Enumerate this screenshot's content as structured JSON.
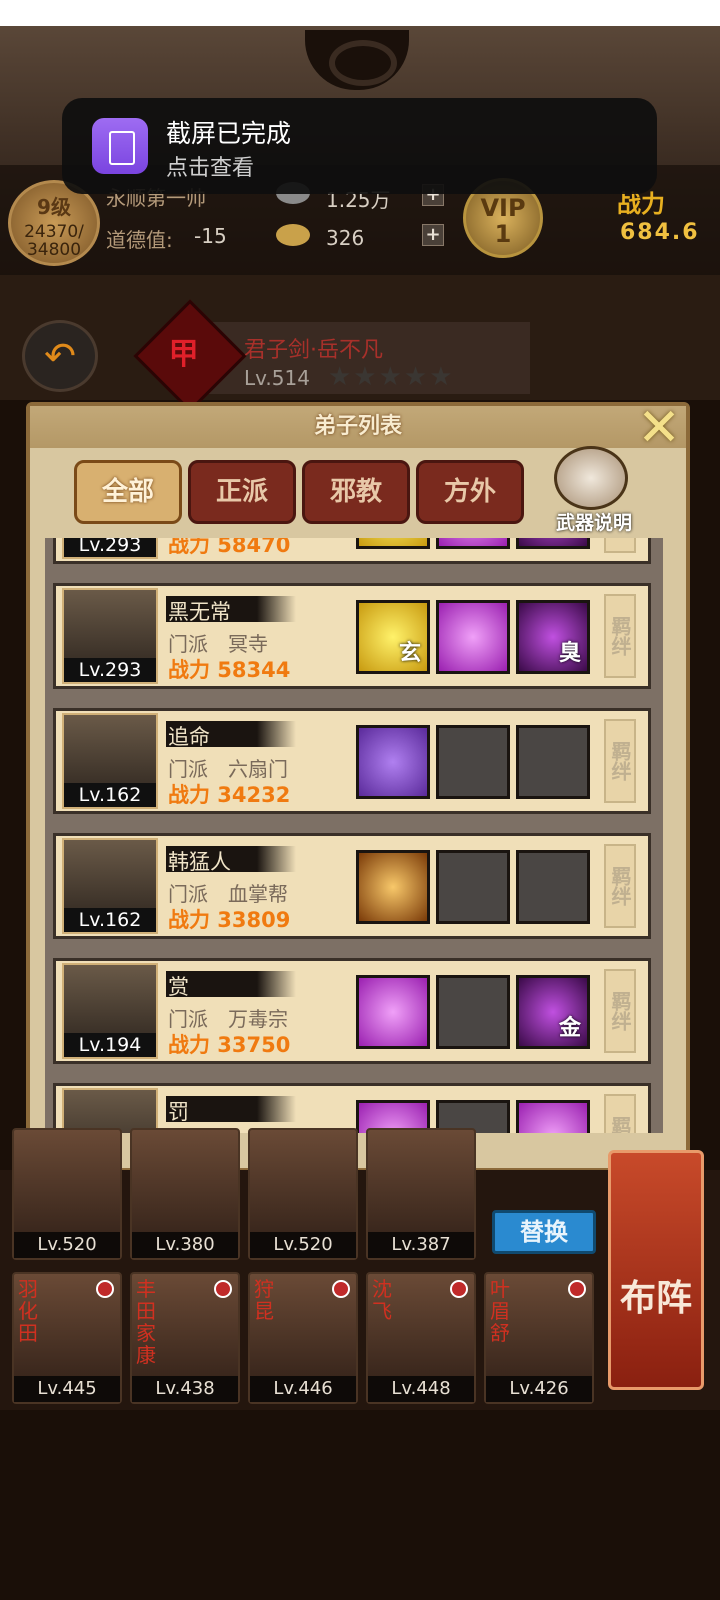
{
  "notification": {
    "title": "截屏已完成",
    "subtitle": "点击查看"
  },
  "player": {
    "level": "9级",
    "exp": "24370/",
    "exp_max": "34800",
    "name": "永顺第一帅",
    "morality_label": "道德值:",
    "morality_value": "-15",
    "silver": "1.25万",
    "gold": "326",
    "vip_label": "VIP",
    "vip_level": "1",
    "power_label": "战力",
    "power_value": "684.6"
  },
  "hero": {
    "rank": "甲等",
    "name": "君子剑·岳不凡",
    "level": "Lv.514",
    "stars": "★★★★★"
  },
  "dialog": {
    "title": "弟子列表",
    "tabs": [
      "全部",
      "正派",
      "邪教",
      "方外"
    ],
    "weapon_label": "武器说明"
  },
  "disciples": [
    {
      "level": "Lv.293",
      "name": "",
      "sect": "",
      "power": "战力 58470",
      "skills": [
        "yellow",
        "purple",
        "dark"
      ],
      "skill_tags": [
        "",
        "",
        ""
      ]
    },
    {
      "level": "Lv.293",
      "name": "黑无常",
      "sect": "门派　冥寺",
      "power": "战力 58344",
      "skills": [
        "yellow",
        "purple",
        "dark"
      ],
      "skill_tags": [
        "玄",
        "",
        "臭"
      ]
    },
    {
      "level": "Lv.162",
      "name": "追命",
      "sect": "门派　六扇门",
      "power": "战力 34232",
      "skills": [
        "violet",
        "empty",
        "empty"
      ],
      "skill_tags": [
        "",
        "",
        ""
      ]
    },
    {
      "level": "Lv.162",
      "name": "韩猛人",
      "sect": "门派　血掌帮",
      "power": "战力 33809",
      "skills": [
        "gold",
        "empty",
        "empty"
      ],
      "skill_tags": [
        "",
        "",
        ""
      ]
    },
    {
      "level": "Lv.194",
      "name": "赏",
      "sect": "门派　万毒宗",
      "power": "战力 33750",
      "skills": [
        "purple",
        "empty",
        "dark"
      ],
      "skill_tags": [
        "",
        "",
        "金"
      ]
    },
    {
      "level": "",
      "name": "罚",
      "sect": "",
      "power": "",
      "skills": [
        "purple",
        "empty",
        "purple"
      ],
      "skill_tags": [
        "",
        "",
        ""
      ]
    }
  ],
  "bond_label": "羁绊",
  "team_row1": [
    {
      "name": "",
      "level": "Lv.520"
    },
    {
      "name": "",
      "level": "Lv.380"
    },
    {
      "name": "",
      "level": "Lv.520"
    },
    {
      "name": "",
      "level": "Lv.387"
    }
  ],
  "replace_label": "替换",
  "team_row2": [
    {
      "name": "羽化田",
      "level": "Lv.445"
    },
    {
      "name": "丰田家康",
      "level": "Lv.438"
    },
    {
      "name": "狩昆",
      "level": "Lv.446"
    },
    {
      "name": "沈飞",
      "level": "Lv.448"
    },
    {
      "name": "叶眉舒",
      "level": "Lv.426"
    }
  ],
  "formation_label": "布阵"
}
